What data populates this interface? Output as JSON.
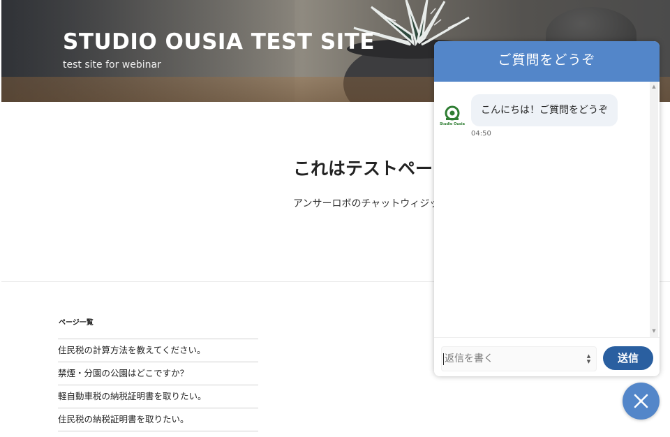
{
  "site": {
    "title": "STUDIO OUSIA TEST SITE",
    "description": "test site for webinar"
  },
  "main": {
    "heading": "これはテストペー",
    "body": "アンサーロボのチャットウィジッ"
  },
  "sidebar_widget": {
    "title": "ページ一覧",
    "pages": [
      "住民税の計算方法を教えてください。",
      "禁煙・分園の公園はどこですか？",
      "軽自動車税の納税証明書を取りたい。",
      "住民税の納税証明書を取りたい。"
    ]
  },
  "chat": {
    "header_title": "ご質問をどうぞ",
    "bot_logo_text": "Studio Ousia",
    "messages": [
      {
        "sender": "bot",
        "text": "こんにちは！ご質問をどうぞ",
        "time": "04:50"
      }
    ],
    "input_placeholder": "返信を書く",
    "send_label": "送信",
    "accent_color": "#5386c9",
    "send_color": "#2a5fa0"
  },
  "icons": {
    "close": "close-icon",
    "avatar": "studio-ousia-logo-icon",
    "scroll_up": "scroll-up-icon",
    "scroll_down": "scroll-down-icon"
  }
}
